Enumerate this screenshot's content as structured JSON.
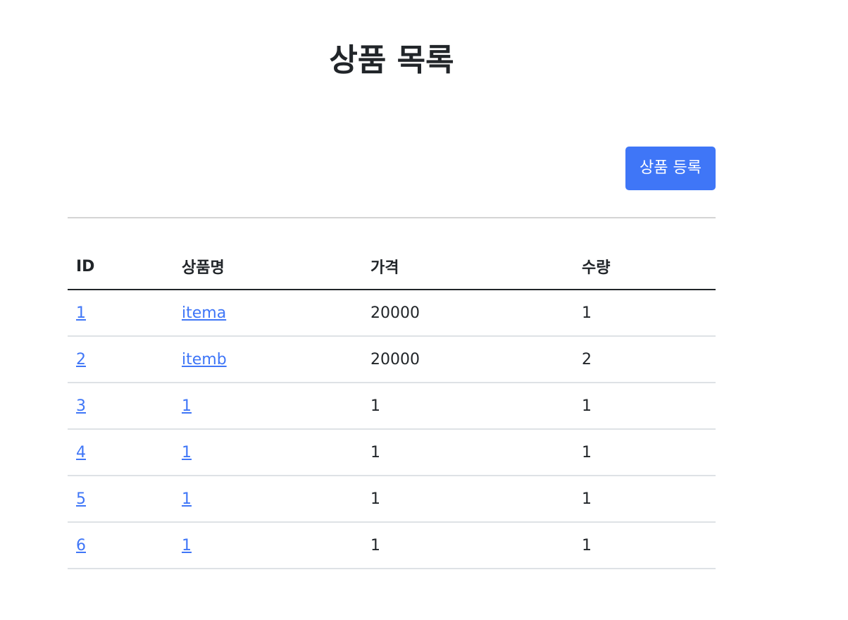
{
  "page": {
    "title": "상품 목록"
  },
  "actions": {
    "register_label": "상품 등록"
  },
  "table": {
    "headers": [
      "ID",
      "상품명",
      "가격",
      "수량"
    ],
    "rows": [
      {
        "id": "1",
        "name": "itema",
        "price": "20000",
        "quantity": "1"
      },
      {
        "id": "2",
        "name": "itemb",
        "price": "20000",
        "quantity": "2"
      },
      {
        "id": "3",
        "name": "1",
        "price": "1",
        "quantity": "1"
      },
      {
        "id": "4",
        "name": "1",
        "price": "1",
        "quantity": "1"
      },
      {
        "id": "5",
        "name": "1",
        "price": "1",
        "quantity": "1"
      },
      {
        "id": "6",
        "name": "1",
        "price": "1",
        "quantity": "1"
      }
    ]
  },
  "colors": {
    "primary": "#3f76f7",
    "text": "#212529",
    "row_border": "#dee2e6"
  }
}
